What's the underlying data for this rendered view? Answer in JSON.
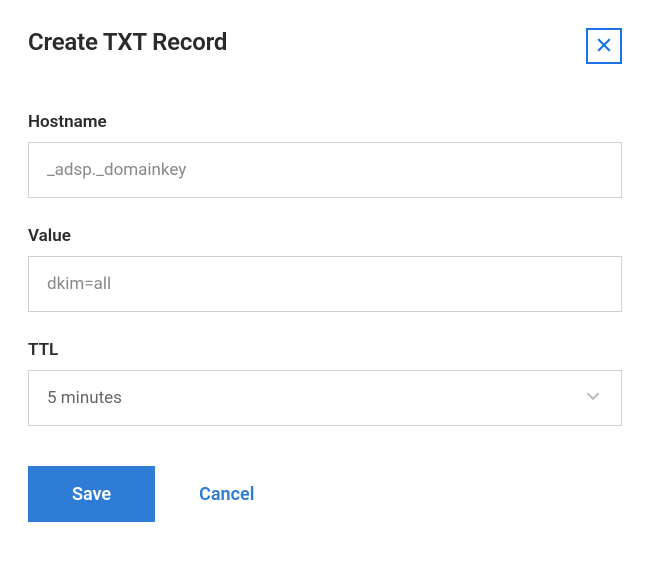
{
  "header": {
    "title": "Create TXT Record"
  },
  "fields": {
    "hostname": {
      "label": "Hostname",
      "value": "_adsp._domainkey"
    },
    "value": {
      "label": "Value",
      "value": "dkim=all"
    },
    "ttl": {
      "label": "TTL",
      "value": "5 minutes"
    }
  },
  "actions": {
    "save": "Save",
    "cancel": "Cancel"
  }
}
